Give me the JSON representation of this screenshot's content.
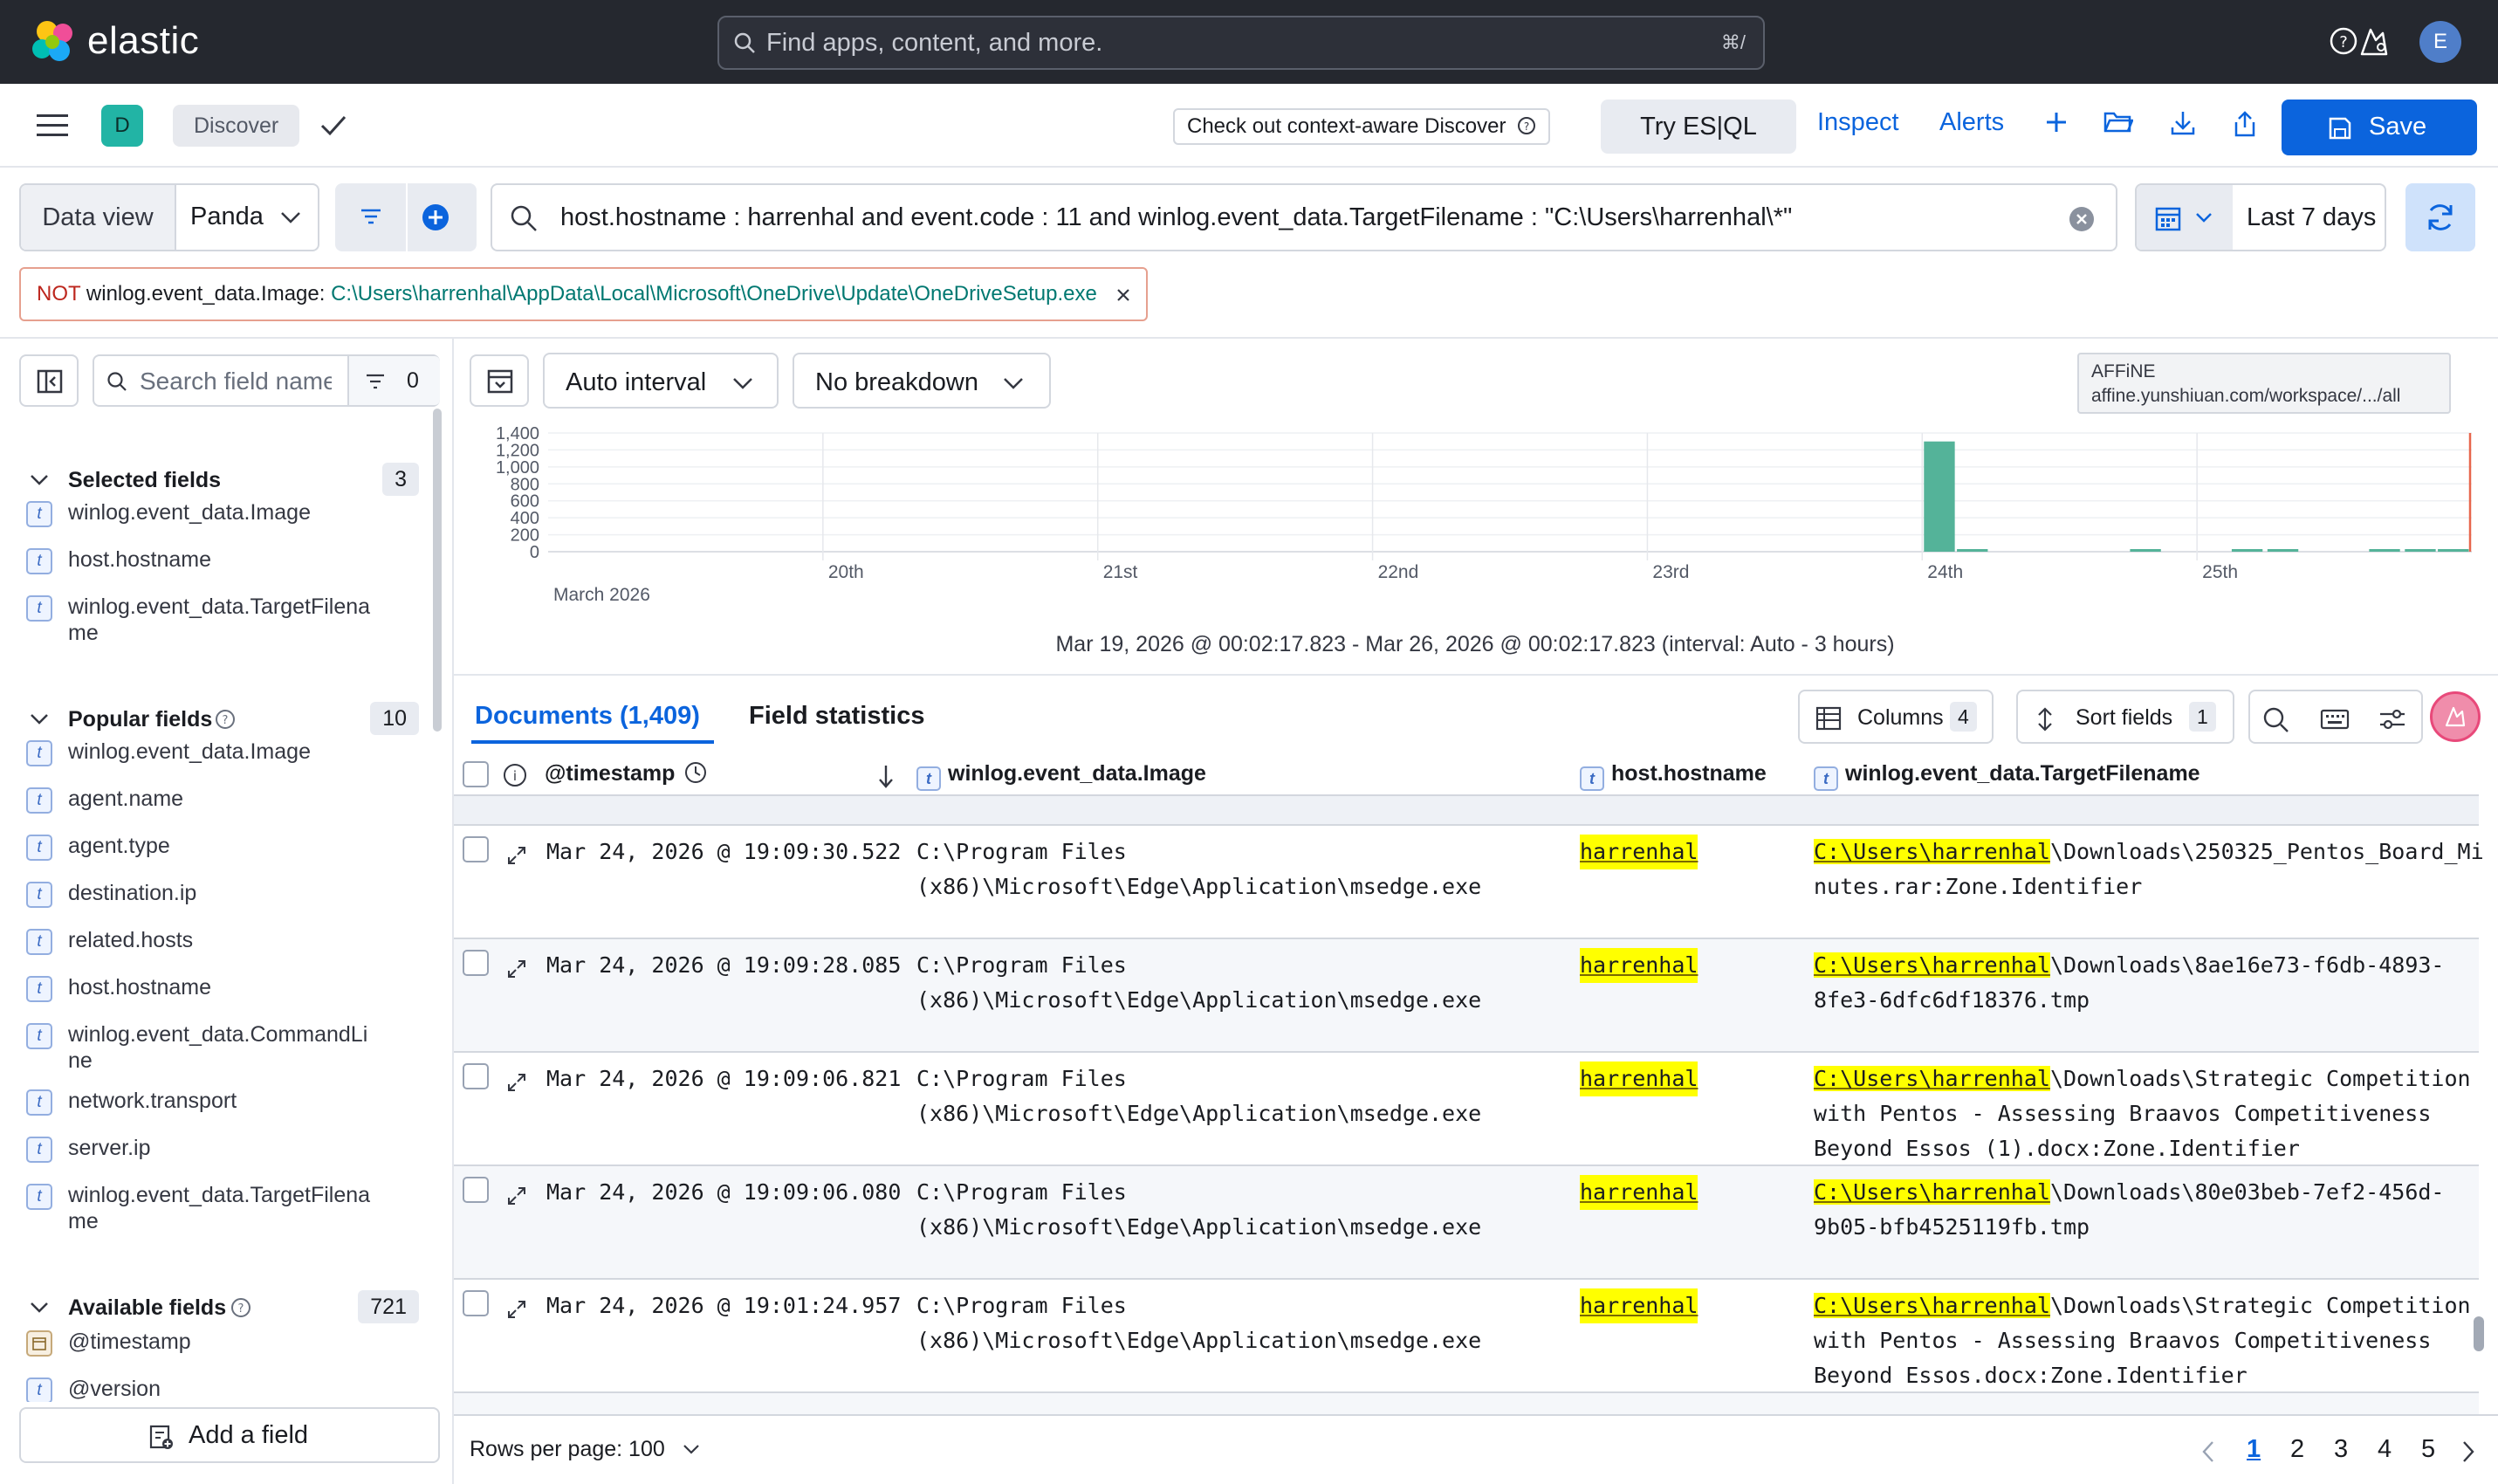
{
  "topbar": {
    "brand": "elastic",
    "search_placeholder": "Find apps, content, and more.",
    "search_shortcut": "⌘/",
    "avatar": "E"
  },
  "appbar": {
    "space": "D",
    "breadcrumb": "Discover",
    "context_button": "Check out context-aware Discover",
    "try_esql": "Try ES|QL",
    "inspect": "Inspect",
    "alerts": "Alerts",
    "save": "Save"
  },
  "query": {
    "data_view_label": "Data view",
    "data_view_value": "Panda",
    "kql": "host.hostname : harrenhal and event.code : 11 and winlog.event_data.TargetFilename : \"C:\\Users\\harrenhal\\*\"",
    "time_range": "Last 7 days"
  },
  "filter_pill": {
    "negation": "NOT",
    "key": "winlog.event_data.Image:",
    "value": "C:\\Users\\harrenhal\\AppData\\Local\\Microsoft\\OneDrive\\Update\\OneDriveSetup.exe"
  },
  "sidebar": {
    "search_placeholder": "Search field names",
    "filter_count": "0",
    "selected": {
      "title": "Selected fields",
      "count": "3",
      "fields": [
        "winlog.event_data.Image",
        "host.hostname",
        "winlog.event_data.TargetFilename"
      ]
    },
    "popular": {
      "title": "Popular fields",
      "count": "10",
      "fields": [
        "winlog.event_data.Image",
        "agent.name",
        "agent.type",
        "destination.ip",
        "related.hosts",
        "host.hostname",
        "winlog.event_data.CommandLine",
        "network.transport",
        "server.ip",
        "winlog.event_data.TargetFilename"
      ]
    },
    "available": {
      "title": "Available fields",
      "count": "721",
      "fields": [
        "@timestamp",
        "@version"
      ]
    },
    "add_field": "Add a field"
  },
  "histogram": {
    "interval": "Auto interval",
    "breakdown": "No breakdown",
    "tooltip_title": "AFFiNE",
    "tooltip_url": "affine.yunshiuan.com/workspace/.../all",
    "range_text": "Mar 19, 2026 @ 00:02:17.823 - Mar 26, 2026 @ 00:02:17.823 (interval: Auto - 3 hours)"
  },
  "chart_data": {
    "type": "bar",
    "y_ticks": [
      "1,400",
      "1,200",
      "1,000",
      "800",
      "600",
      "400",
      "200",
      "0"
    ],
    "ylim": [
      0,
      1400
    ],
    "x_ticks": [
      "20th",
      "21st",
      "22nd",
      "23rd",
      "24th",
      "25th"
    ],
    "x_sublabel": "March 2026",
    "bars": [
      {
        "day_offset": 5.0,
        "value": 1300
      },
      {
        "day_offset": 5.12,
        "value": 25
      },
      {
        "day_offset": 5.75,
        "value": 28
      },
      {
        "day_offset": 6.12,
        "value": 22
      },
      {
        "day_offset": 6.25,
        "value": 22
      },
      {
        "day_offset": 6.62,
        "value": 25
      },
      {
        "day_offset": 6.75,
        "value": 25
      },
      {
        "day_offset": 6.87,
        "value": 25
      }
    ],
    "grid": true,
    "color": "#54b399"
  },
  "documents": {
    "tab_docs": "Documents (1,409)",
    "tab_stats": "Field statistics",
    "columns_label": "Columns",
    "columns_count": "4",
    "sort_label": "Sort fields",
    "sort_count": "1",
    "headers": {
      "timestamp": "@timestamp",
      "image": "winlog.event_data.Image",
      "hostname": "host.hostname",
      "target": "winlog.event_data.TargetFilename"
    },
    "rows": [
      {
        "timestamp": "Mar 24, 2026 @ 19:09:30.522",
        "image1": "C:\\Program Files",
        "image2": "(x86)\\Microsoft\\Edge\\Application\\msedge.exe",
        "host": "harrenhal",
        "target_hl": "C:\\Users\\harrenhal",
        "target1": "\\Downloads\\250325_Pentos_Board_Mi",
        "target2": "nutes.rar:Zone.Identifier",
        "target3": ""
      },
      {
        "timestamp": "Mar 24, 2026 @ 19:09:28.085",
        "image1": "C:\\Program Files",
        "image2": "(x86)\\Microsoft\\Edge\\Application\\msedge.exe",
        "host": "harrenhal",
        "target_hl": "C:\\Users\\harrenhal",
        "target1": "\\Downloads\\8ae16e73-f6db-4893-",
        "target2": "8fe3-6dfc6df18376.tmp",
        "target3": ""
      },
      {
        "timestamp": "Mar 24, 2026 @ 19:09:06.821",
        "image1": "C:\\Program Files",
        "image2": "(x86)\\Microsoft\\Edge\\Application\\msedge.exe",
        "host": "harrenhal",
        "target_hl": "C:\\Users\\harrenhal",
        "target1": "\\Downloads\\Strategic Competition",
        "target2": "with Pentos - Assessing Braavos Competitiveness",
        "target3": "Beyond Essos (1).docx:Zone.Identifier"
      },
      {
        "timestamp": "Mar 24, 2026 @ 19:09:06.080",
        "image1": "C:\\Program Files",
        "image2": "(x86)\\Microsoft\\Edge\\Application\\msedge.exe",
        "host": "harrenhal",
        "target_hl": "C:\\Users\\harrenhal",
        "target1": "\\Downloads\\80e03beb-7ef2-456d-",
        "target2": "9b05-bfb4525119fb.tmp",
        "target3": ""
      },
      {
        "timestamp": "Mar 24, 2026 @ 19:01:24.957",
        "image1": "C:\\Program Files",
        "image2": "(x86)\\Microsoft\\Edge\\Application\\msedge.exe",
        "host": "harrenhal",
        "target_hl": "C:\\Users\\harrenhal",
        "target1": "\\Downloads\\Strategic Competition",
        "target2": "with Pentos - Assessing Braavos Competitiveness",
        "target3": "Beyond Essos.docx:Zone.Identifier"
      }
    ]
  },
  "pagination": {
    "rows_per_page": "Rows per page: 100",
    "pages": [
      "1",
      "2",
      "3",
      "4",
      "5"
    ],
    "active": "1"
  }
}
